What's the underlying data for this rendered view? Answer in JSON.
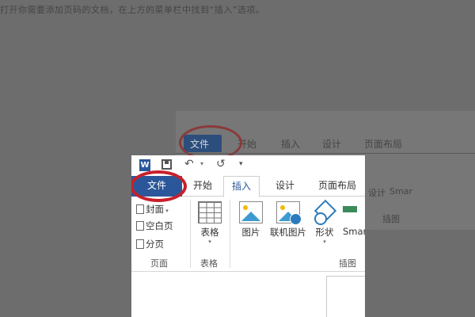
{
  "background": {
    "instruction_text": "打开你需要添加页码的文档，在上方的菜单栏中找到“插入”选项。",
    "ghost_tabs": [
      "文件",
      "开始",
      "插入",
      "设计",
      "页面布局"
    ],
    "ghost_groups": [
      "设计",
      "Smar",
      "插图"
    ]
  },
  "window": {
    "qat": {
      "word_icon_letter": "W",
      "undo_glyph": "↶",
      "redo_glyph": "↺",
      "more_glyph": "▾"
    },
    "tabs": [
      {
        "label": "文件"
      },
      {
        "label": "开始"
      },
      {
        "label": "插入"
      },
      {
        "label": "设计"
      },
      {
        "label": "页面布局"
      }
    ],
    "pages_group": {
      "items": [
        "封面",
        "空白页",
        "分页"
      ],
      "label": "页面"
    },
    "tables_group": {
      "button": "表格",
      "label": "表格"
    },
    "illustrations_group": {
      "buttons": [
        "图片",
        "联机图片",
        "形状",
        "Smar"
      ],
      "label": "插图"
    }
  },
  "colors": {
    "accent": "#2b579a",
    "highlight_ring": "#c8202a",
    "dim_overlay": "#6d6d6d"
  }
}
